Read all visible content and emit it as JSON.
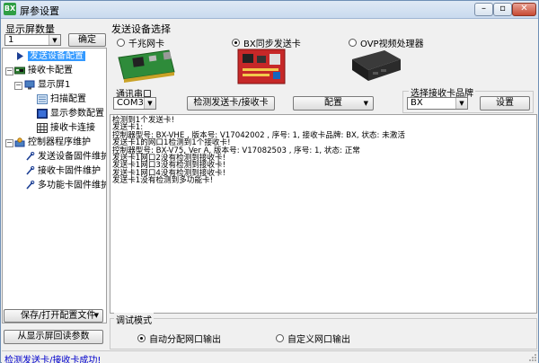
{
  "window": {
    "title": "屏参设置",
    "app_icon": "app-icon",
    "controls": [
      "minimize-icon",
      "maximize-icon",
      "close-icon"
    ]
  },
  "left": {
    "count_label": "显示屏数量",
    "count_value": "1",
    "confirm_button": "确定",
    "tree": [
      {
        "label": "发送设备配置",
        "icon": "send-arrow-icon",
        "selected": true
      },
      {
        "label": "接收卡配置",
        "icon": "receive-card-icon"
      },
      {
        "label": "显示屏1",
        "icon": "monitor-icon"
      },
      {
        "label": "扫描配置",
        "icon": "scan-config-icon"
      },
      {
        "label": "显示参数配置",
        "icon": "display-params-icon"
      },
      {
        "label": "接收卡连接",
        "icon": "grid-connection-icon"
      },
      {
        "label": "控制器程序维护",
        "icon": "controller-maintenance-icon"
      },
      {
        "label": "发送设备固件维护",
        "icon": "firmware-icon"
      },
      {
        "label": "接收卡固件维护",
        "icon": "firmware-icon"
      },
      {
        "label": "多功能卡固件维护",
        "icon": "firmware-icon"
      }
    ],
    "save_open_button": "保存/打开配置文件",
    "read_params_button": "从显示屏回读参数"
  },
  "right": {
    "section_title": "发送设备选择",
    "device_options": [
      {
        "label": "千兆网卡",
        "selected": false
      },
      {
        "label": "BX同步发送卡",
        "selected": true
      },
      {
        "label": "OVP视频处理器",
        "selected": false
      }
    ],
    "serial_label": "通讯串口",
    "serial_value": "COM3",
    "detect_button": "检测发送卡/接收卡",
    "config_button": "配置",
    "brand_group_title": "选择接收卡品牌",
    "brand_value": "BX",
    "settings_button": "设置",
    "log_lines": [
      "检测到1个发送卡!",
      "发送卡1:",
      "控制器型号: BX-VHE ,   版本号: V17042002 ,   序号: 1,   接收卡品牌: BX,   状态: 未激活",
      "发送卡1的网口1检测到1个接收卡!",
      "控制器型号: BX-V75, Ver A,   版本号: V17082503 ,   序号: 1,   状态: 正常",
      "发送卡1网口2没有检测到接收卡!",
      "发送卡1网口3没有检测到接收卡!",
      "发送卡1网口4没有检测到接收卡!",
      "发送卡1没有检测到多功能卡!"
    ],
    "debug_group_title": "调试模式",
    "debug_options": [
      {
        "label": "自动分配网口输出",
        "selected": true
      },
      {
        "label": "自定义网口输出",
        "selected": false
      }
    ]
  },
  "status": {
    "text": "检测发送卡/接收卡成功!"
  },
  "colors": {
    "selection": "#3399ff",
    "status_text": "#0000cc",
    "window_border": "#6e8fb5"
  }
}
